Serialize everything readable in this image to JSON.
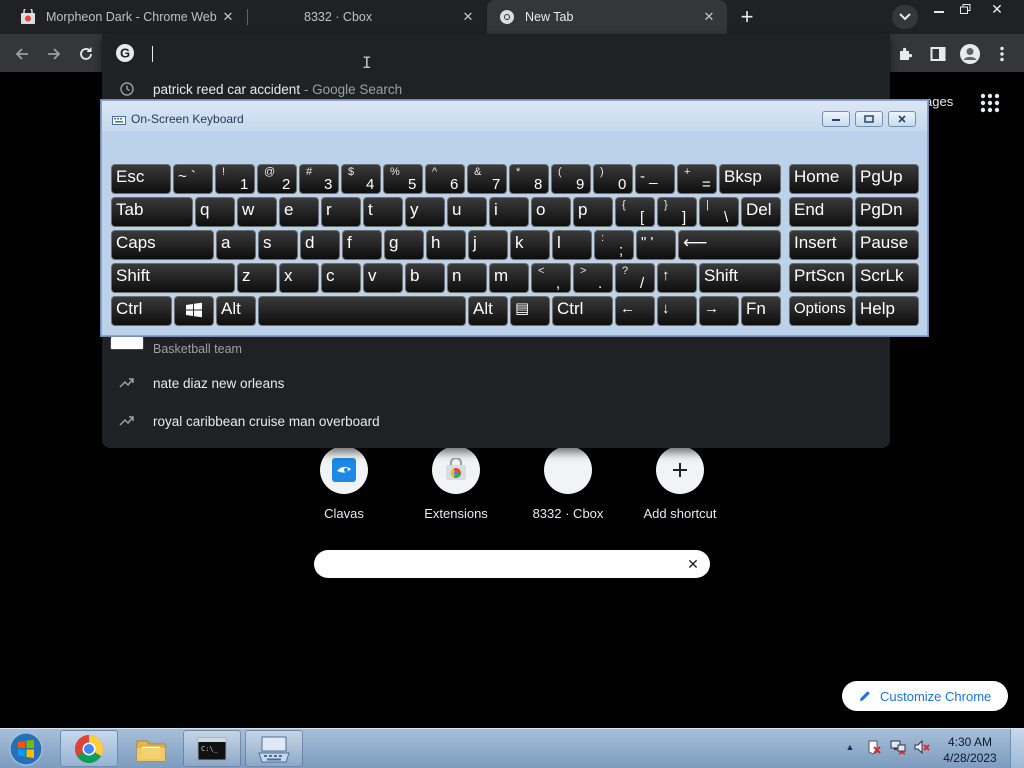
{
  "browser": {
    "tabs": [
      {
        "title": "Morpheon Dark - Chrome Web S",
        "active": false
      },
      {
        "title": "8332 · Cbox",
        "active": false
      },
      {
        "title": "New Tab",
        "active": true
      }
    ]
  },
  "omnibox": {
    "value": "",
    "suggestions": [
      {
        "text": "patrick reed car accident",
        "sub": " - Google Search",
        "icon": "history-icon"
      },
      {
        "text": "Basketball team",
        "sub": "",
        "icon": "entity-image"
      },
      {
        "text": "nate diaz new orleans",
        "sub": "",
        "icon": "trending-icon"
      },
      {
        "text": "royal caribbean cruise man overboard",
        "sub": "",
        "icon": "trending-icon"
      }
    ]
  },
  "ntp": {
    "images_link": "ages",
    "shortcuts": [
      {
        "label": "Clavas",
        "icon": "clavas-icon"
      },
      {
        "label": "Extensions",
        "icon": "chrome-web-store-icon"
      },
      {
        "label": "8332 · Cbox",
        "icon": "blank-icon"
      },
      {
        "label": "Add shortcut",
        "icon": "plus-icon"
      }
    ],
    "search_placeholder": "",
    "customize_label": "Customize Chrome"
  },
  "osk": {
    "title": "On-Screen Keyboard",
    "rows": [
      [
        {
          "main": "Esc",
          "w": 60
        },
        {
          "main": "~ `",
          "w": 40,
          "small": true
        },
        {
          "up": "!",
          "low": "1",
          "w": 40
        },
        {
          "up": "@",
          "low": "2",
          "w": 40
        },
        {
          "up": "#",
          "low": "3",
          "w": 40
        },
        {
          "up": "$",
          "low": "4",
          "w": 40
        },
        {
          "up": "%",
          "low": "5",
          "w": 40
        },
        {
          "up": "^",
          "low": "6",
          "w": 40
        },
        {
          "up": "&",
          "low": "7",
          "w": 40
        },
        {
          "up": "*",
          "low": "8",
          "w": 40
        },
        {
          "up": "(",
          "low": "9",
          "w": 40
        },
        {
          "up": ")",
          "low": "0",
          "w": 40
        },
        {
          "main": "- _",
          "w": 40,
          "small": true
        },
        {
          "up": "+",
          "low": "=",
          "w": 40
        },
        {
          "main": "Bksp",
          "w": 62
        },
        {
          "gap": 6
        },
        {
          "main": "Home",
          "w": 64
        },
        {
          "main": "PgUp",
          "w": 64
        }
      ],
      [
        {
          "main": "Tab",
          "w": 82
        },
        {
          "main": "q",
          "w": 40
        },
        {
          "main": "w",
          "w": 40
        },
        {
          "main": "e",
          "w": 40
        },
        {
          "main": "r",
          "w": 40
        },
        {
          "main": "t",
          "w": 40
        },
        {
          "main": "y",
          "w": 40
        },
        {
          "main": "u",
          "w": 40
        },
        {
          "main": "i",
          "w": 40
        },
        {
          "main": "o",
          "w": 40
        },
        {
          "main": "p",
          "w": 40
        },
        {
          "up": "{",
          "low": "[",
          "w": 40
        },
        {
          "up": "}",
          "low": "]",
          "w": 40
        },
        {
          "up": "|",
          "low": "\\",
          "w": 40
        },
        {
          "main": "Del",
          "w": 40
        },
        {
          "gap": 6
        },
        {
          "main": "End",
          "w": 64
        },
        {
          "main": "PgDn",
          "w": 64
        }
      ],
      [
        {
          "main": "Caps",
          "w": 103
        },
        {
          "main": "a",
          "w": 40
        },
        {
          "main": "s",
          "w": 40
        },
        {
          "main": "d",
          "w": 40
        },
        {
          "main": "f",
          "w": 40
        },
        {
          "main": "g",
          "w": 40
        },
        {
          "main": "h",
          "w": 40
        },
        {
          "main": "j",
          "w": 40
        },
        {
          "main": "k",
          "w": 40
        },
        {
          "main": "l",
          "w": 40
        },
        {
          "up": ":",
          "low": ";",
          "w": 40
        },
        {
          "main": "\" '",
          "w": 40,
          "small": true
        },
        {
          "main": "⟵",
          "w": 103
        },
        {
          "gap": 6
        },
        {
          "main": "Insert",
          "w": 64
        },
        {
          "main": "Pause",
          "w": 64
        }
      ],
      [
        {
          "main": "Shift",
          "w": 124
        },
        {
          "main": "z",
          "w": 40
        },
        {
          "main": "x",
          "w": 40
        },
        {
          "main": "c",
          "w": 40
        },
        {
          "main": "v",
          "w": 40
        },
        {
          "main": "b",
          "w": 40
        },
        {
          "main": "n",
          "w": 40
        },
        {
          "main": "m",
          "w": 40
        },
        {
          "up": "<",
          "low": ",",
          "w": 40
        },
        {
          "up": ">",
          "low": ".",
          "w": 40
        },
        {
          "up": "?",
          "low": "/",
          "w": 40
        },
        {
          "main": "↑",
          "w": 40,
          "small": true
        },
        {
          "main": "Shift",
          "w": 82
        },
        {
          "gap": 6
        },
        {
          "main": "PrtScn",
          "w": 64
        },
        {
          "main": "ScrLk",
          "w": 64
        }
      ],
      [
        {
          "main": "Ctrl",
          "w": 61
        },
        {
          "main": "win",
          "w": 40,
          "win": true
        },
        {
          "main": "Alt",
          "w": 40
        },
        {
          "main": "",
          "w": 208
        },
        {
          "main": "Alt",
          "w": 40
        },
        {
          "main": "▤",
          "w": 40,
          "small": true
        },
        {
          "main": "Ctrl",
          "w": 61
        },
        {
          "main": "←",
          "w": 40,
          "small": true
        },
        {
          "main": "↓",
          "w": 40,
          "small": true
        },
        {
          "main": "→",
          "w": 40,
          "small": true
        },
        {
          "main": "Fn",
          "w": 40
        },
        {
          "gap": 6
        },
        {
          "main": "Options",
          "w": 64,
          "small": true
        },
        {
          "main": "Help",
          "w": 64
        }
      ]
    ]
  },
  "taskbar": {
    "time": "4:30 AM",
    "date": "4/28/2023"
  },
  "colors": {
    "accent": "#1a73e8",
    "osk_frame": "#bcd2ea",
    "key_face": "#1e1e1e"
  }
}
